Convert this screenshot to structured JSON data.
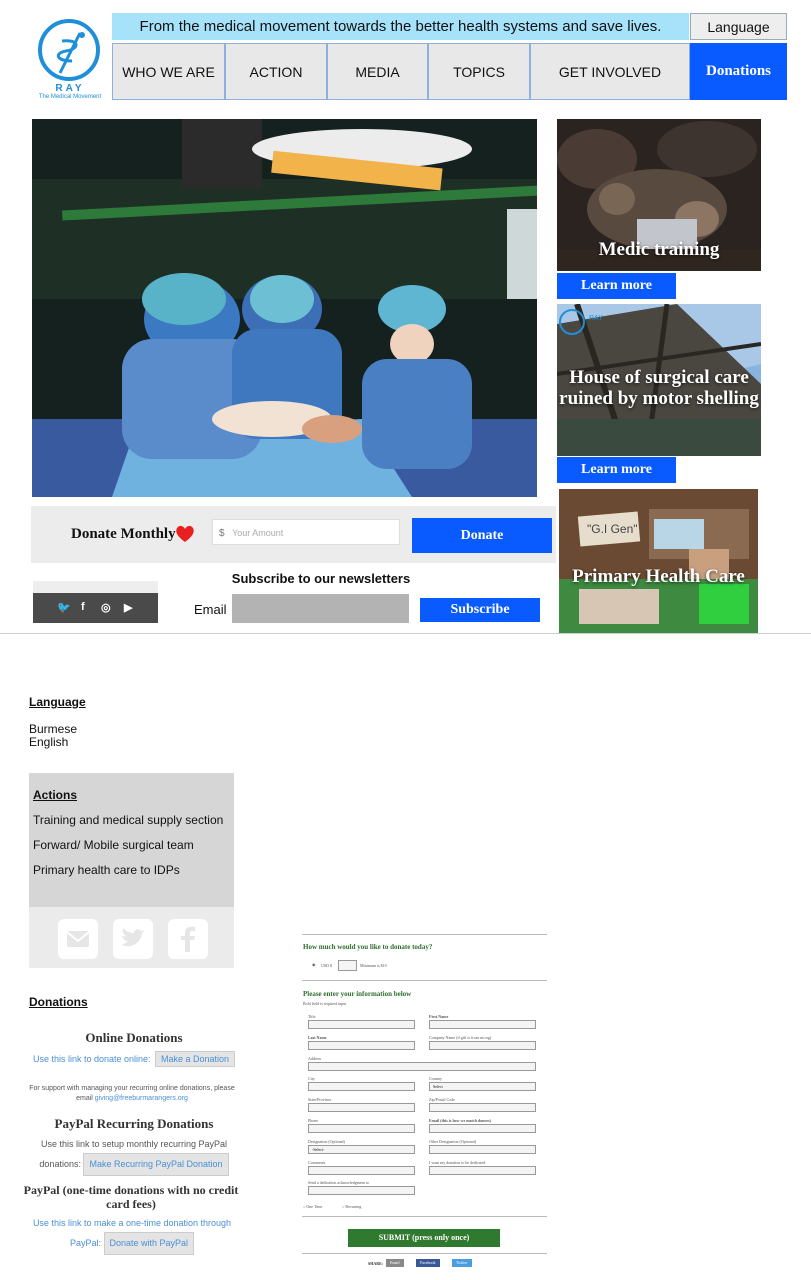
{
  "header": {
    "logo_text": "RAY",
    "logo_subtitle": "The Medical Movement",
    "tagline": "From the medical movement towards the better health systems and save lives.",
    "language_button": "Language",
    "nav": [
      "WHO WE ARE",
      "ACTION",
      "MEDIA",
      "TOPICS",
      "GET INVOLVED",
      "Donations"
    ]
  },
  "cards": [
    {
      "title": "Medic training",
      "button": "Learn more"
    },
    {
      "title": "House of surgical care ruined by motor shelling",
      "button": "Learn more"
    },
    {
      "title": "Primary Health Care"
    }
  ],
  "donate": {
    "label": "Donate Monthly",
    "currency": "$",
    "placeholder": "Your Amount",
    "button": "Donate"
  },
  "newsletter": {
    "title": "Subscribe to our newsletters",
    "email_label": "Email",
    "button": "Subscribe"
  },
  "language_panel": {
    "title": "Language",
    "options": [
      "Burmese",
      "English"
    ]
  },
  "actions_panel": {
    "title": "Actions",
    "items": [
      "Training and medical supply section",
      "Forward/ Mobile surgical team",
      "Primary health care to IDPs"
    ]
  },
  "donations_panel": {
    "title": "Donations",
    "online_head": "Online Donations",
    "online_text": "Use this link to donate online:",
    "online_button": "Make a Donation",
    "support_text": "For support with managing your recurring online donations, please email",
    "support_email": "giving@freeburmarangers.org",
    "paypal_rec_head": "PayPal Recurring Donations",
    "paypal_rec_text": "Use this link to setup monthly recurring PayPal donations:",
    "paypal_rec_button": "Make Recurring PayPal Donation",
    "paypal_one_head": "PayPal (one-time donations with no credit card fees)",
    "paypal_one_text": "Use this link to make a one-time donation through PayPal:",
    "paypal_one_button": "Donate with PayPal"
  },
  "form": {
    "q1": "How much would you like to donate today?",
    "currency": "USD $",
    "minimum": "Minimum is $10",
    "q2": "Please enter your information below",
    "required_note": "Bold field is required input",
    "fields": [
      "Title",
      "First Name",
      "Last Name",
      "Company Name (if gift is from an org)",
      "Address",
      "City",
      "Country",
      "State/Province",
      "Zip/Postal Code",
      "Phone",
      "Email (this is how we match donors)",
      "Designation (Optional)",
      "Other Designation (Optional)",
      "Comments",
      "I want my donation to be dedicated",
      "Send a dedication acknowledgment to"
    ],
    "select_placeholder": "Select",
    "select_placeholder2": "-Select-",
    "one_time": "One Time",
    "recurring": "Recurring",
    "submit": "SUBMIT (press only once)",
    "share_label": "SHARE:",
    "share_buttons": [
      "Email",
      "Facebook",
      "Twitter"
    ]
  },
  "colors": {
    "accent": "#0a5bff",
    "tagline_bg": "#a6e3fb",
    "logo": "#1e8fd8",
    "form_green": "#2f7a2f"
  }
}
